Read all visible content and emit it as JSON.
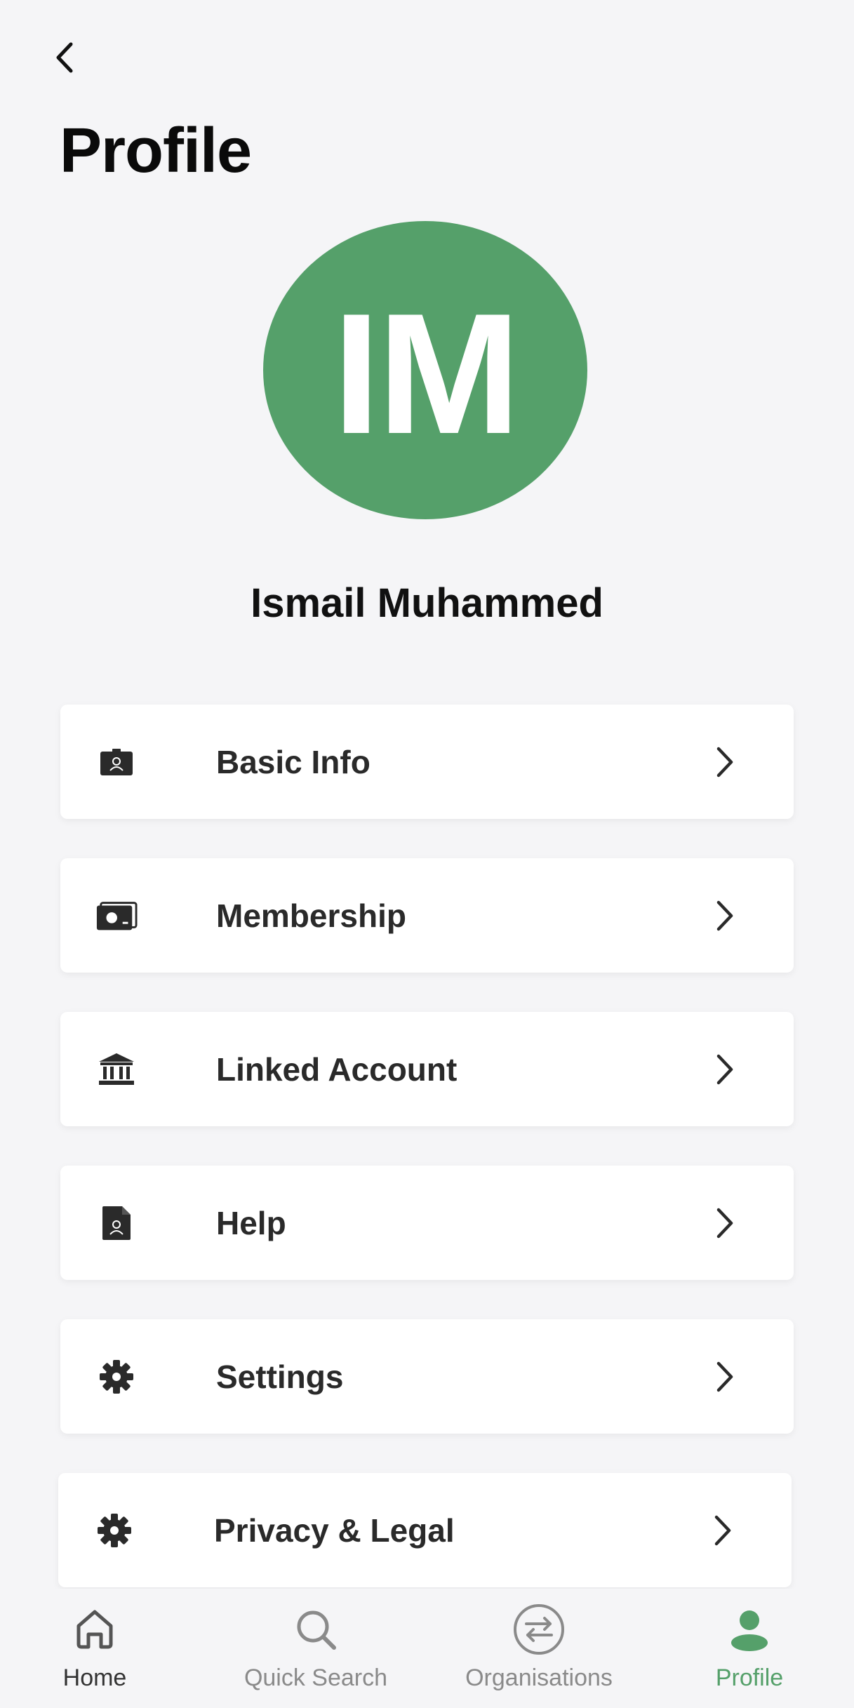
{
  "header": {
    "back_icon": "chevron-left-icon",
    "title": "Profile"
  },
  "profile": {
    "initials": "IM",
    "name": "Ismail Muhammed",
    "avatar_color": "#55a06a"
  },
  "menu": {
    "items": [
      {
        "label": "Basic Info",
        "icon": "id-badge-icon"
      },
      {
        "label": "Membership",
        "icon": "membership-card-icon"
      },
      {
        "label": "Linked Account",
        "icon": "bank-icon"
      },
      {
        "label": "Help",
        "icon": "document-user-icon"
      },
      {
        "label": "Settings",
        "icon": "gear-icon"
      },
      {
        "label": "Privacy & Legal",
        "icon": "gear-icon"
      }
    ]
  },
  "tabbar": {
    "tabs": [
      {
        "label": "Home",
        "icon": "home-icon",
        "active": false
      },
      {
        "label": "Quick Search",
        "icon": "search-icon",
        "active": false
      },
      {
        "label": "Organisations",
        "icon": "swap-arrows-icon",
        "active": false
      },
      {
        "label": "Profile",
        "icon": "user-icon",
        "active": true
      }
    ]
  },
  "colors": {
    "accent": "#55a06a",
    "background": "#f5f5f7",
    "inactive_tab": "#8a8a8a"
  }
}
